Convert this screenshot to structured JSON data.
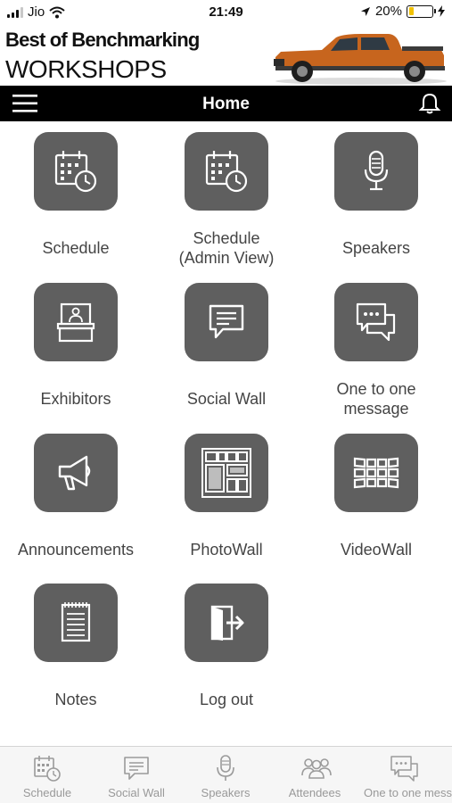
{
  "status_bar": {
    "carrier": "Jio",
    "time": "21:49",
    "battery": "20%",
    "battery_level": 0.2
  },
  "brand": {
    "line1": "Best of Benchmarking",
    "line2": "WORKSHOPS"
  },
  "nav": {
    "title": "Home"
  },
  "tiles": [
    {
      "label": "Schedule",
      "icon": "calendar-clock-icon"
    },
    {
      "label": "Schedule (Admin View)",
      "icon": "calendar-clock-icon"
    },
    {
      "label": "Speakers",
      "icon": "microphone-icon"
    },
    {
      "label": "Exhibitors",
      "icon": "exhibitor-booth-icon"
    },
    {
      "label": "Social Wall",
      "icon": "chat-bubble-icon"
    },
    {
      "label": "One to one message",
      "icon": "message-bubbles-icon"
    },
    {
      "label": "Announcements",
      "icon": "megaphone-icon"
    },
    {
      "label": "PhotoWall",
      "icon": "photo-collage-icon"
    },
    {
      "label": "VideoWall",
      "icon": "video-wall-icon"
    },
    {
      "label": "Notes",
      "icon": "notepad-icon"
    },
    {
      "label": "Log out",
      "icon": "logout-door-icon"
    }
  ],
  "tabs": [
    {
      "label": "Schedule",
      "icon": "calendar-clock-icon"
    },
    {
      "label": "Social Wall",
      "icon": "chat-bubble-icon"
    },
    {
      "label": "Speakers",
      "icon": "microphone-icon"
    },
    {
      "label": "Attendees",
      "icon": "people-icon"
    },
    {
      "label": "One to one message",
      "icon": "message-bubbles-icon"
    }
  ]
}
